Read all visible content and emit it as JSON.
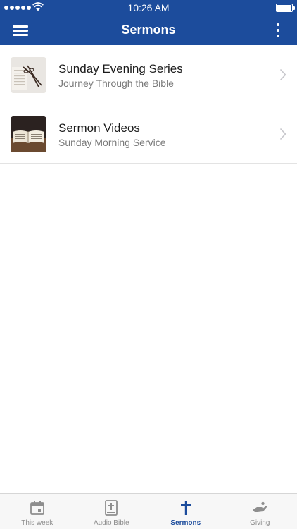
{
  "status_bar": {
    "time": "10:26 AM"
  },
  "nav": {
    "title": "Sermons"
  },
  "list": [
    {
      "title": "Sunday Evening Series",
      "subtitle": "Journey Through the Bible",
      "thumbnail": "glasses-on-book"
    },
    {
      "title": "Sermon Videos",
      "subtitle": "Sunday Morning Service",
      "thumbnail": "open-bible"
    }
  ],
  "tabs": [
    {
      "label": "This week",
      "icon": "calendar-icon",
      "active": false
    },
    {
      "label": "Audio Bible",
      "icon": "bible-icon",
      "active": false
    },
    {
      "label": "Sermons",
      "icon": "cross-icon",
      "active": true
    },
    {
      "label": "Giving",
      "icon": "giving-hand-icon",
      "active": false
    }
  ],
  "colors": {
    "primary": "#1c4c9c",
    "inactive": "#8e8e8e",
    "separator": "#e3e3e3"
  }
}
